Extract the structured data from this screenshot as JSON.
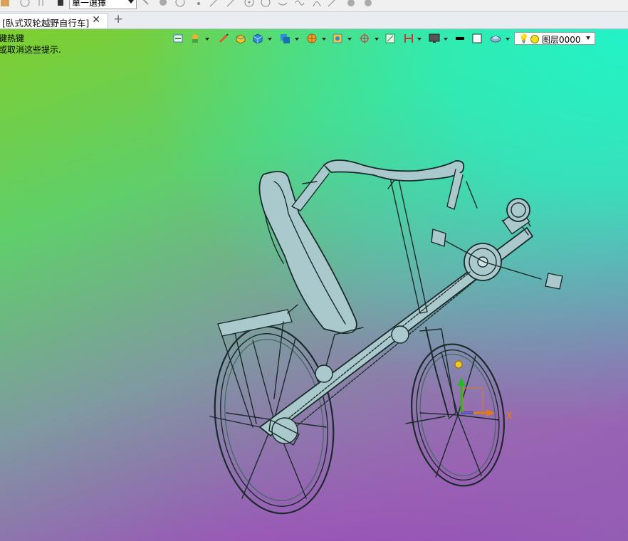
{
  "toolbar": {
    "selection_mode": "單一選擇",
    "icons": [
      "app-icon",
      "info-icon",
      "filter-icon",
      "select-arrow-icon",
      "select-pattern-icon",
      "play-icon",
      "snap-point-icon",
      "line-icon",
      "arrow-tool-icon",
      "circle-center-icon",
      "arc-icon",
      "curve-icon",
      "wave-icon",
      "arch-icon",
      "pointer-icon",
      "hand-icon",
      "rotate-icon"
    ]
  },
  "tabs": [
    {
      "label": "[臥式双轮越野自行车]",
      "close": "✕"
    }
  ],
  "new_tab": "+",
  "hints": {
    "line1": "键热键",
    "line2": "或取消这些提示."
  },
  "view_toolbar": {
    "icons": [
      "view-orient-icon",
      "render-mode-icon",
      "pen-icon",
      "box-style-icon",
      "cube-icon",
      "cube-view-icon",
      "sphere-icon",
      "display-filter-icon",
      "snap-icon",
      "measure-icon",
      "section-icon",
      "monitor-icon",
      "line-color-icon",
      "fill-color-icon",
      "view-style-icon"
    ],
    "layer": {
      "name": "图层0000",
      "bulb": "💡"
    }
  },
  "colors": {
    "model_stroke": "#1b2a2a",
    "model_fill": "#a9c9cc",
    "axis_x": "#e07b18",
    "axis_y": "#2ab52a",
    "axis_z": "#2448e0"
  },
  "axis_labels": {
    "x": "X"
  }
}
